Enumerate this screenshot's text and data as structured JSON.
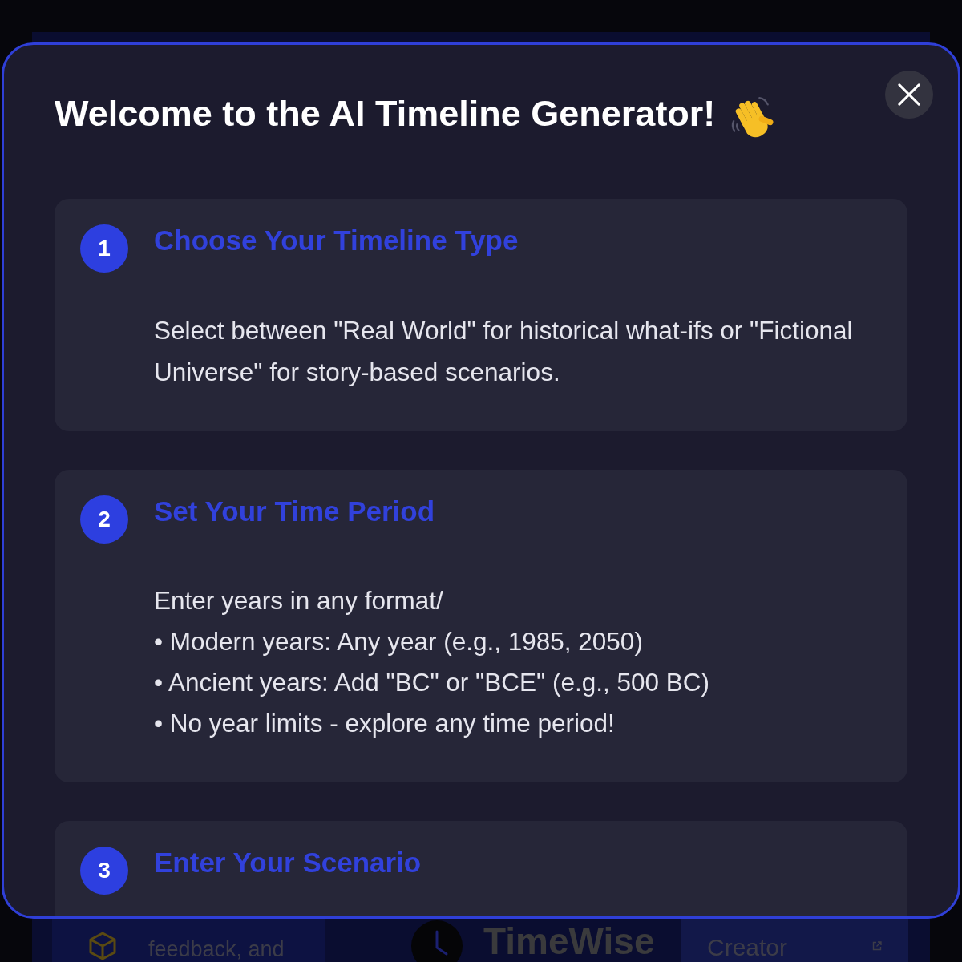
{
  "background_page": {
    "footer": {
      "feedback_text": "feedback, and",
      "brand": "TimeWise",
      "support_link": "Creator"
    }
  },
  "modal": {
    "title": "Welcome to the AI Timeline Generator!",
    "steps": [
      {
        "number": "1",
        "title": "Choose Your Timeline Type",
        "paragraphs": [
          "Select between \"Real World\" for historical what-ifs or \"Fictional Universe\" for story-based scenarios."
        ]
      },
      {
        "number": "2",
        "title": "Set Your Time Period",
        "paragraphs": [
          "Enter years in any format/",
          "• Modern years: Any year (e.g., 1985, 2050)",
          "• Ancient years: Add \"BC\" or \"BCE\" (e.g., 500 BC)",
          "• No year limits - explore any time period!"
        ]
      },
      {
        "number": "3",
        "title": "Enter Your Scenario"
      }
    ]
  }
}
